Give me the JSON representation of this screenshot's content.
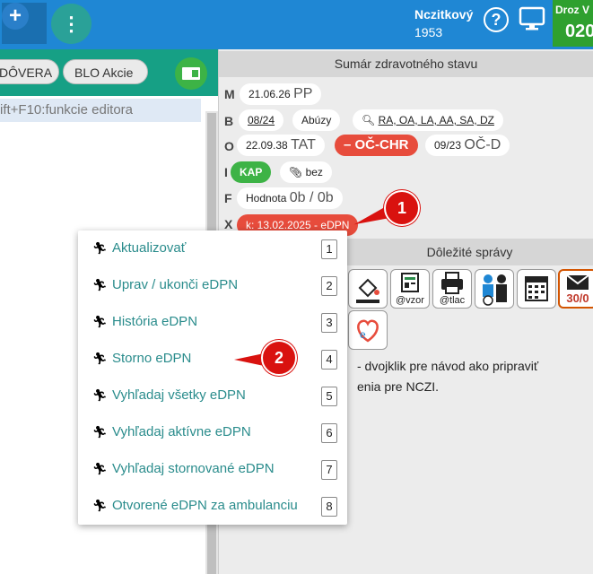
{
  "topbar": {
    "plus_label": "+",
    "more_label": "⋮",
    "user_name": "Nczitkový",
    "user_year": "1953",
    "help_label": "?",
    "doctor_tag": "Droz V",
    "doctor_code": "020"
  },
  "left_toolbar": {
    "doverat_label": "DÔVERA",
    "blo_label": "BLO Akcie"
  },
  "left_pane": {
    "shortcut_hint": "ift+F10:funkcie editora"
  },
  "summary": {
    "header": "Sumár zdravotného stavu",
    "rows": {
      "M": {
        "label": "M",
        "date": "21.06.26",
        "code": "PP"
      },
      "B": {
        "label": "B",
        "date": "08/24",
        "abuzy": "Abúzy",
        "allergies": "RA, OA, LA, AA, SA, DZ"
      },
      "O": {
        "label": "O",
        "date": "22.09.38",
        "code": "TAT",
        "och_label": "OČ-CHR",
        "date2": "09/23",
        "code2": "OČ-D"
      },
      "I": {
        "label": "I",
        "kap": "KAP",
        "bez": "bez"
      },
      "F": {
        "label": "F",
        "hodnota": "Hodnota",
        "value": "0b / 0b"
      },
      "X": {
        "label": "X",
        "k_text": "k: 13.02.2025 - eDPN"
      }
    }
  },
  "messages": {
    "header": "Dôležité správy",
    "tools": [
      {
        "caption": ""
      },
      {
        "caption": "@vzor"
      },
      {
        "caption": "@tlac"
      },
      {
        "caption": ""
      },
      {
        "caption": ""
      },
      {
        "caption": "30/0"
      }
    ],
    "info_line1": "- dvojklik pre návod ako pripraviť",
    "info_line2": "enia pre NCZI."
  },
  "context_menu": {
    "items": [
      {
        "label": "Aktualizovať",
        "key": "1"
      },
      {
        "label": "Uprav / ukonči eDPN",
        "key": "2"
      },
      {
        "label": "História eDPN",
        "key": "3"
      },
      {
        "label": "Storno eDPN",
        "key": "4"
      },
      {
        "label": "Vyhľadaj všetky eDPN",
        "key": "5"
      },
      {
        "label": "Vyhľadaj aktívne eDPN",
        "key": "6"
      },
      {
        "label": "Vyhľadaj stornované eDPN",
        "key": "7"
      },
      {
        "label": "Otvorené eDPN za ambulanciu",
        "key": "8"
      }
    ]
  },
  "callouts": {
    "first": "1",
    "second": "2"
  },
  "colors": {
    "topbar": "#1f87d4",
    "teal": "#16a085",
    "green": "#3db346",
    "red": "#e74c3c",
    "callout": "#d9120f"
  }
}
